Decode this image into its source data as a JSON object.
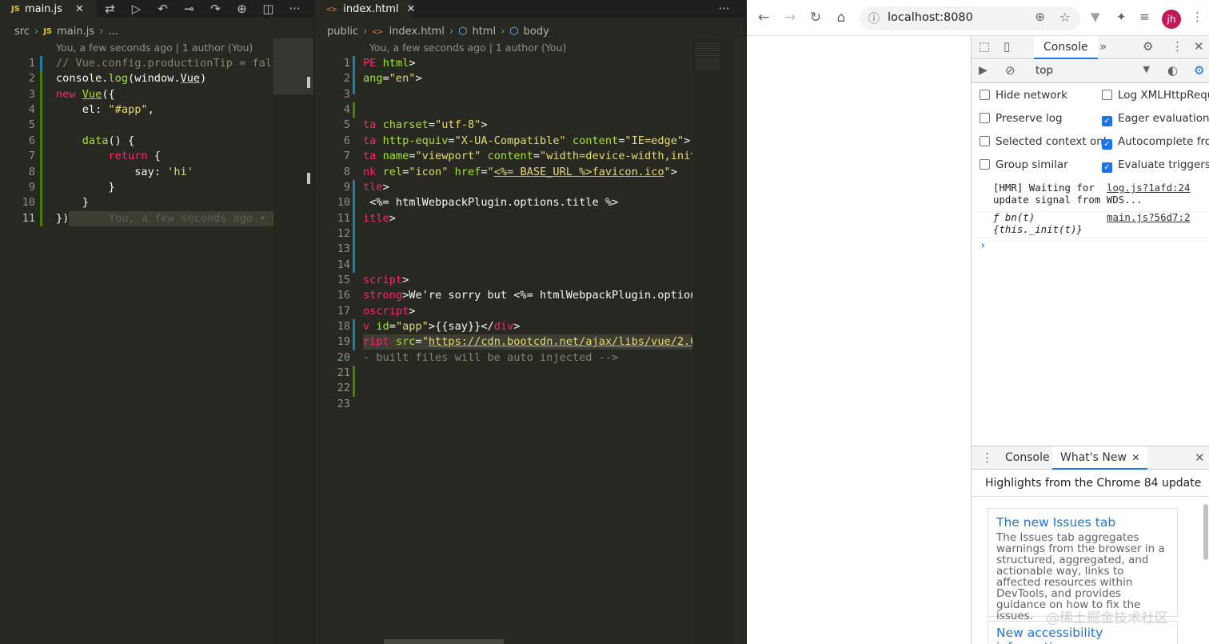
{
  "left_editor": {
    "tab_title": "main.js",
    "tab_close": "✕",
    "tab_badge": "JS",
    "breadcrumb": [
      "src",
      "main.js",
      "..."
    ],
    "commit_info": "You, a few seconds ago | 1 author (You)",
    "line_numbers": [
      "1",
      "2",
      "3",
      "4",
      "5",
      "6",
      "7",
      "8",
      "9",
      "10",
      "11"
    ],
    "inline_blame": "You, a few seconds ago • U"
  },
  "right_editor": {
    "tab_title": "index.html",
    "tab_close": "✕",
    "breadcrumb": [
      "public",
      "index.html",
      "html",
      "body"
    ],
    "commit_info": "You, a few seconds ago | 1 author (You)",
    "line_numbers": [
      "1",
      "2",
      "3",
      "4",
      "5",
      "6",
      "7",
      "8",
      "9",
      "10",
      "11",
      "12",
      "13",
      "14",
      "15",
      "16",
      "17",
      "18",
      "19",
      "20",
      "21",
      "22",
      "23"
    ],
    "more": "···"
  },
  "browser": {
    "url": "localhost:8080",
    "avatar_initials": "jh",
    "devtools": {
      "main_tab": "Console",
      "context": "top",
      "options_left": [
        {
          "label": "Hide network",
          "checked": false
        },
        {
          "label": "Preserve log",
          "checked": false
        },
        {
          "label": "Selected context onl",
          "checked": false
        },
        {
          "label": "Group similar",
          "checked": false
        }
      ],
      "options_right": [
        {
          "label": "Log XMLHttpReque",
          "checked": false
        },
        {
          "label": "Eager evaluation",
          "checked": true
        },
        {
          "label": "Autocomplete from",
          "checked": true
        },
        {
          "label": "Evaluate triggers us",
          "checked": true
        }
      ],
      "logs": [
        {
          "text": "[HMR] Waiting for\nupdate signal from WDS...",
          "source": "log.js?1afd:24"
        },
        {
          "text": "ƒ bn(t)\n{this._init(t)}",
          "source": "main.js?56d7:2"
        }
      ],
      "prompt": "›",
      "drawer_tabs": [
        "Console",
        "What's New"
      ],
      "drawer_close": "✕",
      "highlights": "Highlights from the Chrome 84 update",
      "card1_title": "The new Issues tab",
      "card1_body": "The Issues tab aggregates warnings from the browser in a structured, aggregated, and actionable way, links to affected resources within DevTools, and provides guidance on how to fix the issues.",
      "card2_title": "New accessibility information"
    }
  },
  "watermark": "@稀土掘金技术社区"
}
